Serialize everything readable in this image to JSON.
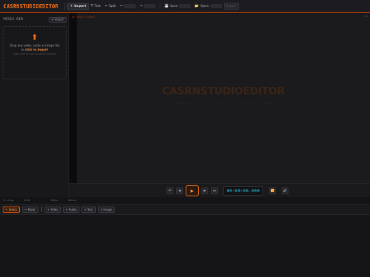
{
  "app": {
    "brand": "CASRNSTUDIOEDITOR"
  },
  "toolbar": {
    "import": {
      "icon": "+",
      "label": "Import"
    },
    "text": {
      "icon": "T",
      "label": "Text"
    },
    "split": {
      "icon": "✂",
      "label": "Split"
    },
    "undo_icon": "↩",
    "redo_icon": "↪",
    "save": {
      "icon": "💾",
      "label": "Save"
    },
    "open": {
      "icon": "📂",
      "label": "Open"
    },
    "export_label": "Export"
  },
  "media_bin": {
    "title": "MEDIA BIN",
    "import_label": "+ Import",
    "drop_arrow": "⬆",
    "drop_text": "Drop any video, audio or image file",
    "drop_or": "or",
    "drop_link": "click to import",
    "drop_sub": "Right-click or hold to add to timeline"
  },
  "preview": {
    "no_media": "NO MEDIA LOADED",
    "corner": "0%",
    "watermark": "CASRNSTUDIOEDITOR",
    "watermark_sub": "IMPORT MEDIA · ADD TO TIMELINE · PREVIEW · EXPORT"
  },
  "transport": {
    "skip_start_icon": "⏮",
    "prev_frame_icon": "◀",
    "play_icon": "▶",
    "next_frame_icon": "▶",
    "skip_end_icon": "⏭",
    "timecode": "00:00:00.000",
    "loop_icon": "🔁",
    "volume_icon": "🔊"
  },
  "status": {
    "clips": "0 clips",
    "duration": "0:00",
    "separator": "·",
    "fps": "30fps",
    "mode": "Select"
  },
  "timeline_toolbar": {
    "select": "↖ Select",
    "razor": "✂ Razor",
    "video": "+ Video",
    "audio": "+ Audio",
    "text": "+ Text",
    "image": "+ Image"
  },
  "colors": {
    "accent": "#f97316",
    "timecode": "#22d3ee"
  }
}
